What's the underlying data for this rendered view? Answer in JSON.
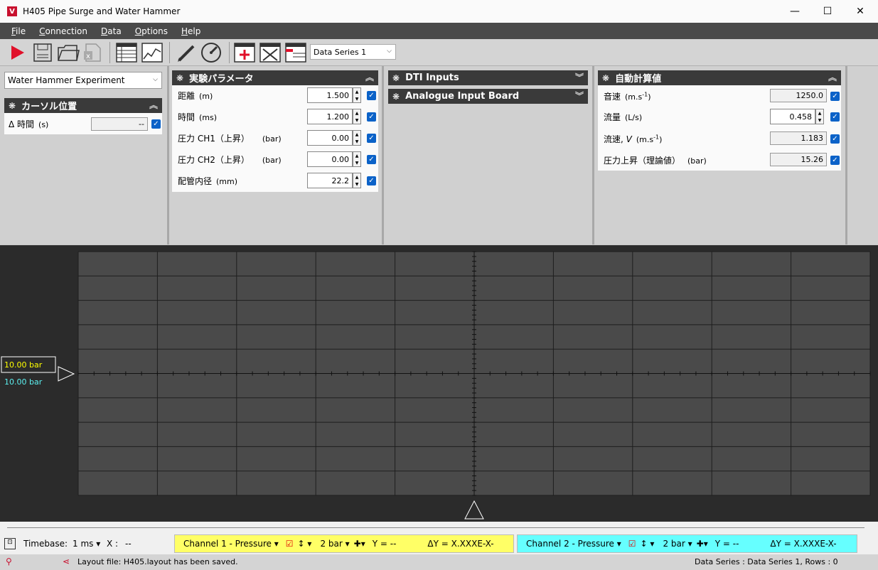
{
  "window": {
    "title": "H405 Pipe Surge and Water Hammer",
    "logo": "V",
    "minimize": "—",
    "maximize": "☐",
    "close": "✕"
  },
  "menu": [
    {
      "label": "File",
      "hotkey": "F",
      "rest": "ile"
    },
    {
      "label": "Connection",
      "hotkey": "C",
      "rest": "onnection"
    },
    {
      "label": "Data",
      "hotkey": "D",
      "rest": "ata"
    },
    {
      "label": "Options",
      "hotkey": "O",
      "rest": "ptions"
    },
    {
      "label": "Help",
      "hotkey": "H",
      "rest": "elp"
    }
  ],
  "toolbar": {
    "series_select": "Data Series 1",
    "icons": [
      "play-icon",
      "save-icon",
      "open-folder-icon",
      "export-excel-icon",
      "table-view-icon",
      "chart-view-icon",
      "edit-icon",
      "gauge-icon",
      "add-series-icon",
      "delete-series-icon",
      "series-table-icon"
    ]
  },
  "experiment": "Water Hammer Experiment",
  "cursor_panel": {
    "title": "カーソル位置",
    "rows": [
      {
        "label": "Δ 時間",
        "unit": "(s)",
        "value": "--"
      }
    ]
  },
  "params_panel": {
    "title": "実験パラメータ",
    "rows": [
      {
        "label": "距離",
        "unit": "(m)",
        "value": "1.500"
      },
      {
        "label": "時間",
        "unit": "(ms)",
        "value": "1.200"
      },
      {
        "label": "圧力 CH1（上昇）",
        "unit": "(bar)",
        "value": "0.00"
      },
      {
        "label": "圧力 CH2（上昇）",
        "unit": "(bar)",
        "value": "0.00"
      },
      {
        "label": "配管内径",
        "unit": "(mm)",
        "value": "22.2"
      }
    ]
  },
  "dti_panel": {
    "title": "DTI Inputs"
  },
  "analogue_panel": {
    "title": "Analogue Input Board"
  },
  "calc_panel": {
    "title": "自動計算値",
    "rows": [
      {
        "label": "音速",
        "unit": "(m.s",
        "sup": "-1",
        "unit_end": ")",
        "value": "1250.0",
        "editable": false
      },
      {
        "label": "流量",
        "unit": "(L/s)",
        "sup": "",
        "unit_end": "",
        "value": "0.458",
        "editable": true
      },
      {
        "label": "流速, ",
        "italic": "V",
        "unit": "(m.s",
        "sup": "-1",
        "unit_end": ")",
        "value": "1.183",
        "editable": false
      },
      {
        "label": "圧力上昇（理論値）",
        "unit": "(bar)",
        "sup": "",
        "unit_end": "",
        "value": "15.26",
        "editable": false
      }
    ]
  },
  "scope": {
    "ch1_scale": "10.00 bar",
    "ch2_scale": "10.00 bar",
    "colors": {
      "ch1": "#ffff00",
      "ch2": "#5cf0f0",
      "grid": "#1e1e1e",
      "plot": "#4a4a4a"
    },
    "x_divisions": 10,
    "y_divisions": 10
  },
  "bottom": {
    "timebase_label": "Timebase:",
    "timebase_value": "1 ms",
    "x_label": "X :",
    "x_value": "--",
    "ch1": {
      "name": "Channel 1 - Pressure",
      "scale": "2 bar",
      "y": "Y = --",
      "dy": "ΔY = X.XXXE-X-"
    },
    "ch2": {
      "name": "Channel 2 - Pressure",
      "scale": "2 bar",
      "y": "Y = --",
      "dy": "ΔY = X.XXXE-X-"
    }
  },
  "status": {
    "message": "Layout file: H405.layout has been saved.",
    "right": "Data Series : Data Series 1,  Rows : 0"
  },
  "chart_data": {
    "type": "line",
    "title": "",
    "xlabel": "",
    "ylabel": "",
    "series": [],
    "grid": true
  }
}
